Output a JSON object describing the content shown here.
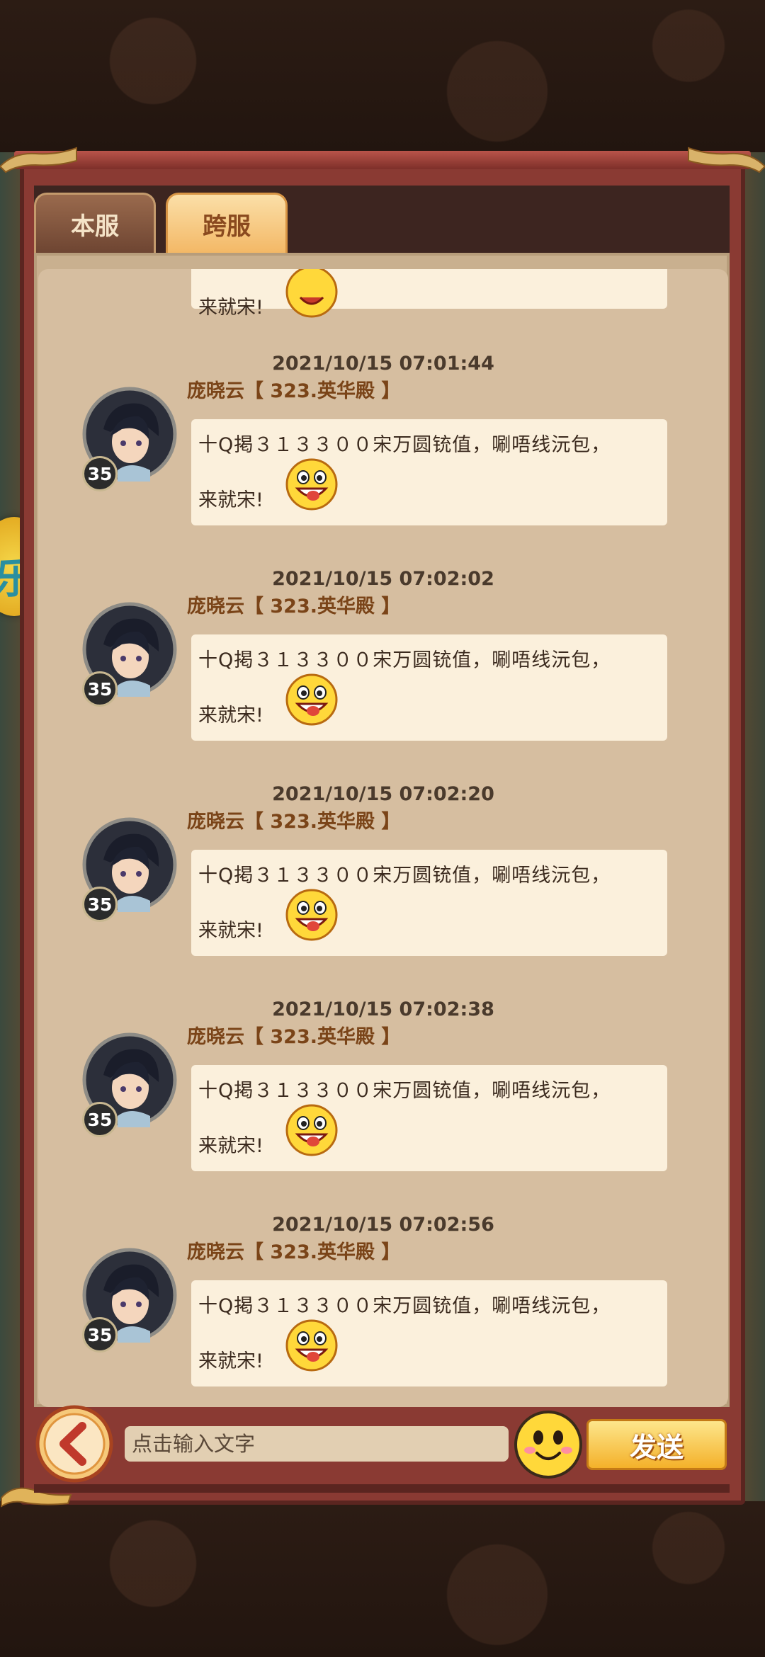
{
  "tabs": [
    {
      "label": "本服",
      "active": false
    },
    {
      "label": "跨服",
      "active": true
    }
  ],
  "partial_message": {
    "line2": "来就宋!"
  },
  "messages": [
    {
      "timestamp": "2021/10/15  07:01:44",
      "sender": "庞晓云【 323.英华殿 】",
      "level": "35",
      "line1": "十Q掲３１３３００宋万圆铳值，唰唔线沅包，",
      "line2": "来就宋!"
    },
    {
      "timestamp": "2021/10/15  07:02:02",
      "sender": "庞晓云【 323.英华殿 】",
      "level": "35",
      "line1": "十Q掲３１３３００宋万圆铳值，唰唔线沅包，",
      "line2": "来就宋!"
    },
    {
      "timestamp": "2021/10/15  07:02:20",
      "sender": "庞晓云【 323.英华殿 】",
      "level": "35",
      "line1": "十Q掲３１３３００宋万圆铳值，唰唔线沅包，",
      "line2": "来就宋!"
    },
    {
      "timestamp": "2021/10/15  07:02:38",
      "sender": "庞晓云【 323.英华殿 】",
      "level": "35",
      "line1": "十Q掲３１３３００宋万圆铳值，唰唔线沅包，",
      "line2": "来就宋!"
    },
    {
      "timestamp": "2021/10/15  07:02:56",
      "sender": "庞晓云【 323.英华殿 】",
      "level": "35",
      "line1": "十Q掲３１３３００宋万圆铳值，唰唔线沅包，",
      "line2": "来就宋!"
    }
  ],
  "input": {
    "placeholder": "点击输入文字"
  },
  "send_label": "发送",
  "side_badge_text": "乐",
  "icons": {
    "back": "chevron-left-icon",
    "emoji": "smiley-face-icon",
    "message_emoji": "tongue-out-face-icon"
  },
  "colors": {
    "frame": "#8a3a33",
    "panel": "#d6bea0",
    "bubble": "#fbf0dc",
    "sender": "#7a4418",
    "send_button": "#f4b12a"
  }
}
